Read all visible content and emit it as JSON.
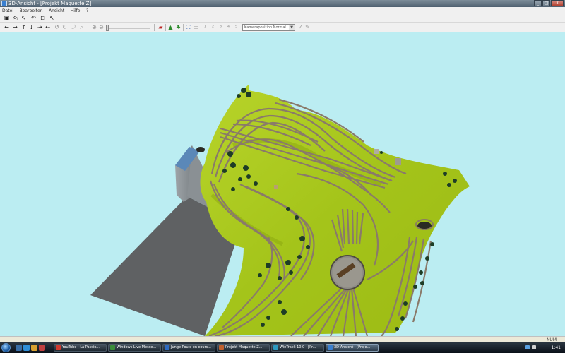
{
  "window": {
    "title": "3D-Ansicht - [Projekt Maquette Z]",
    "buttons": [
      "_",
      "□",
      "X"
    ]
  },
  "menu": [
    "Datei",
    "Bearbeiten",
    "Ansicht",
    "Hilfe",
    "?"
  ],
  "toolbar2": {
    "camera_select": "Kameraposition Normal"
  },
  "status": {
    "num": "NUM"
  },
  "taskbar": {
    "tasks": [
      {
        "label": "YouTube - La Passio...",
        "icon_color": "#d03a2e"
      },
      {
        "label": "Windows Live Messe...",
        "icon_color": "#3a8c3a"
      },
      {
        "label": "Junge Poule en cours...",
        "icon_color": "#2e6ac0"
      },
      {
        "label": "Projekt Maquette Z...",
        "icon_color": "#c0602e"
      },
      {
        "label": "WinTrack 10.0 - [Pr...",
        "icon_color": "#2e9ac0"
      },
      {
        "label": "3D-Ansicht - [Proje...",
        "icon_color": "#3a7fd0",
        "active": true
      }
    ],
    "clock": "1:41"
  },
  "colors": {
    "sky": "#bbedf2",
    "terrain": "#a8c81e",
    "terrain_dark": "#7f9a10",
    "building": "#8e9498",
    "base": "#5e6062",
    "track": "#8a7a6a"
  }
}
